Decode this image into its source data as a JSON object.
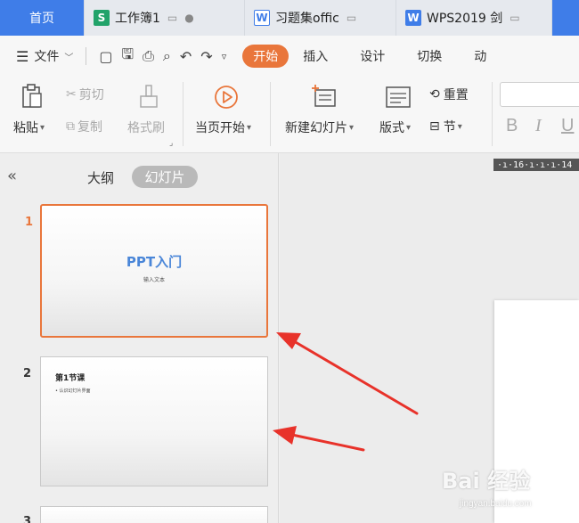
{
  "tabs": [
    {
      "label": "首页"
    },
    {
      "label": "工作簿1",
      "icon": "S"
    },
    {
      "label": "习题集offic",
      "icon": "W"
    },
    {
      "label": "WPS2019 剑",
      "icon": "W"
    }
  ],
  "menu": {
    "file_label": "文件",
    "ribbon_tabs": [
      "开始",
      "插入",
      "设计",
      "切换",
      "动"
    ]
  },
  "ribbon": {
    "paste": "粘贴",
    "cut": "剪切",
    "copy": "复制",
    "format_painter": "格式刷",
    "start_from_current": "当页开始",
    "new_slide": "新建幻灯片",
    "layout": "版式",
    "reset": "重置",
    "section": "节",
    "bold": "B",
    "italic": "I",
    "underline": "U"
  },
  "panel": {
    "outline_label": "大纲",
    "slides_label": "幻灯片"
  },
  "slides": [
    {
      "number": "1",
      "title": "PPT入门",
      "subtitle": "输入文本"
    },
    {
      "number": "2",
      "title": "第1节课",
      "bullet": "• 认识幻灯片界面"
    },
    {
      "number": "3"
    }
  ],
  "ruler": {
    "text": "·ı·16·ı·ı·ı·14"
  },
  "watermark": {
    "text": "Bai 经验",
    "sub": "jingyan.baidu.com"
  },
  "colors": {
    "accent_orange": "#e9763b",
    "tab_blue": "#3f7de8",
    "arrow_red": "#e8322a"
  }
}
